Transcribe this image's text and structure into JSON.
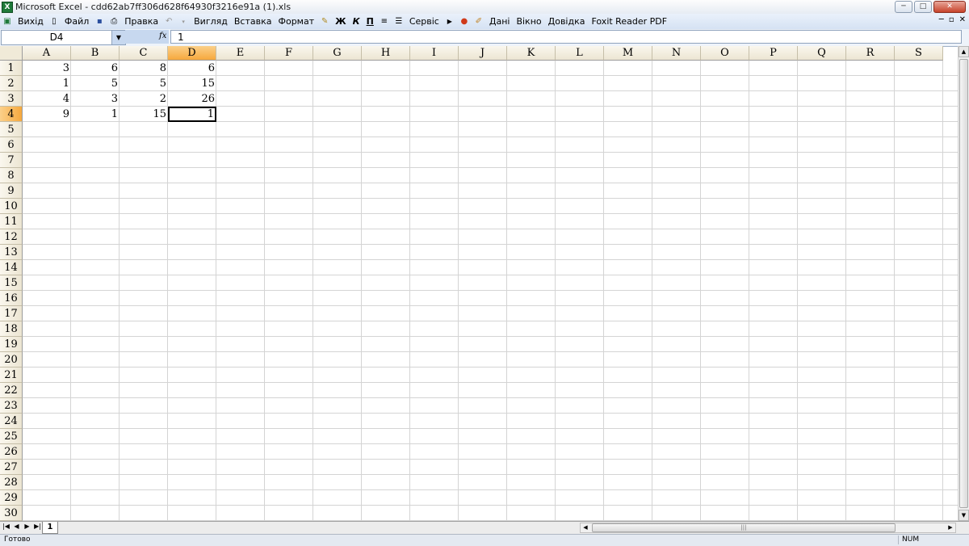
{
  "window": {
    "title": "Microsoft Excel - cdd62ab7ff306d628f64930f3216e91a (1).xls",
    "min_label": "─",
    "max_label": "□",
    "close_label": "✕"
  },
  "menu": {
    "items": [
      "Вихід",
      "Файл",
      "Правка",
      "Вигляд",
      "Вставка",
      "Формат",
      "Ж",
      "К",
      "П",
      "Сервіс",
      "Дані",
      "Вікно",
      "Довідка",
      "Foxit Reader PDF"
    ],
    "mdi": [
      "─",
      "▫",
      "✕"
    ]
  },
  "formula_bar": {
    "name_box": "D4",
    "fx": "fx",
    "value": "1"
  },
  "sheet": {
    "columns": [
      "A",
      "B",
      "C",
      "D",
      "E",
      "F",
      "G",
      "H",
      "I",
      "J",
      "K",
      "L",
      "M",
      "N",
      "O",
      "P",
      "Q",
      "R",
      "S"
    ],
    "active_column": "D",
    "active_row": 4,
    "rows": [
      "1",
      "2",
      "3",
      "4",
      "5",
      "6",
      "7",
      "8",
      "9",
      "10",
      "11",
      "12",
      "13",
      "14",
      "15",
      "16",
      "17",
      "18",
      "19",
      "20",
      "21",
      "22",
      "23",
      "24",
      "25",
      "26",
      "27",
      "28",
      "29",
      "30"
    ],
    "data": [
      [
        "3",
        "6",
        "8",
        "6"
      ],
      [
        "1",
        "5",
        "5",
        "15"
      ],
      [
        "4",
        "3",
        "2",
        "26"
      ],
      [
        "9",
        "1",
        "15",
        "1"
      ]
    ],
    "tabs": [
      "1"
    ],
    "active_tab": "1"
  },
  "status": {
    "left": "Готово",
    "num": "NUM"
  },
  "colors": {
    "header_active": "#f6a83d",
    "gridline": "#d4d4d4"
  }
}
